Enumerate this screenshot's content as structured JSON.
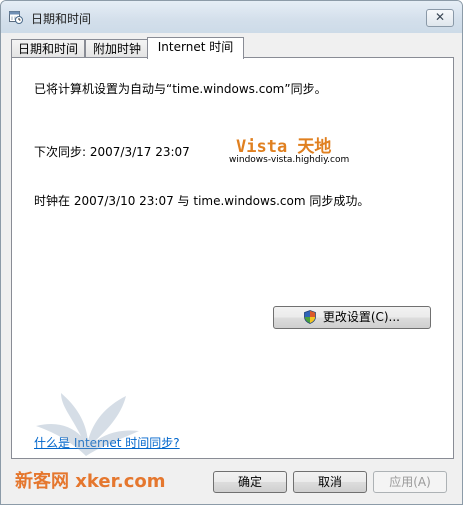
{
  "window": {
    "title": "日期和时间",
    "close_glyph": "✕"
  },
  "tabs": [
    {
      "label": "日期和时间",
      "active": false
    },
    {
      "label": "附加时钟",
      "active": false
    },
    {
      "label": "Internet 时间",
      "active": true
    }
  ],
  "panel": {
    "sync_config_text": "已将计算机设置为自动与“time.windows.com”同步。",
    "next_sync_text": "下次同步: 2007/3/17 23:07",
    "last_sync_text": "时钟在 2007/3/10 23:07 与 time.windows.com 同步成功。",
    "change_settings_label": "更改设置(C)...",
    "help_link": "什么是 Internet 时间同步?"
  },
  "watermarks": {
    "vista_title": "Vista 天地",
    "vista_url": "windows-vista.highdiy.com",
    "bottom_text": "新客网 xker.com"
  },
  "footer": {
    "ok_label": "确定",
    "cancel_label": "取消",
    "apply_label": "应用(A)"
  },
  "colors": {
    "link": "#0066cc",
    "watermark_orange": "#e08020",
    "panel_bg": "#ffffff",
    "window_bg": "#f0f0f0"
  },
  "icons": {
    "title": "calendar-clock-icon",
    "close": "close-icon",
    "uac": "uac-shield-icon"
  }
}
